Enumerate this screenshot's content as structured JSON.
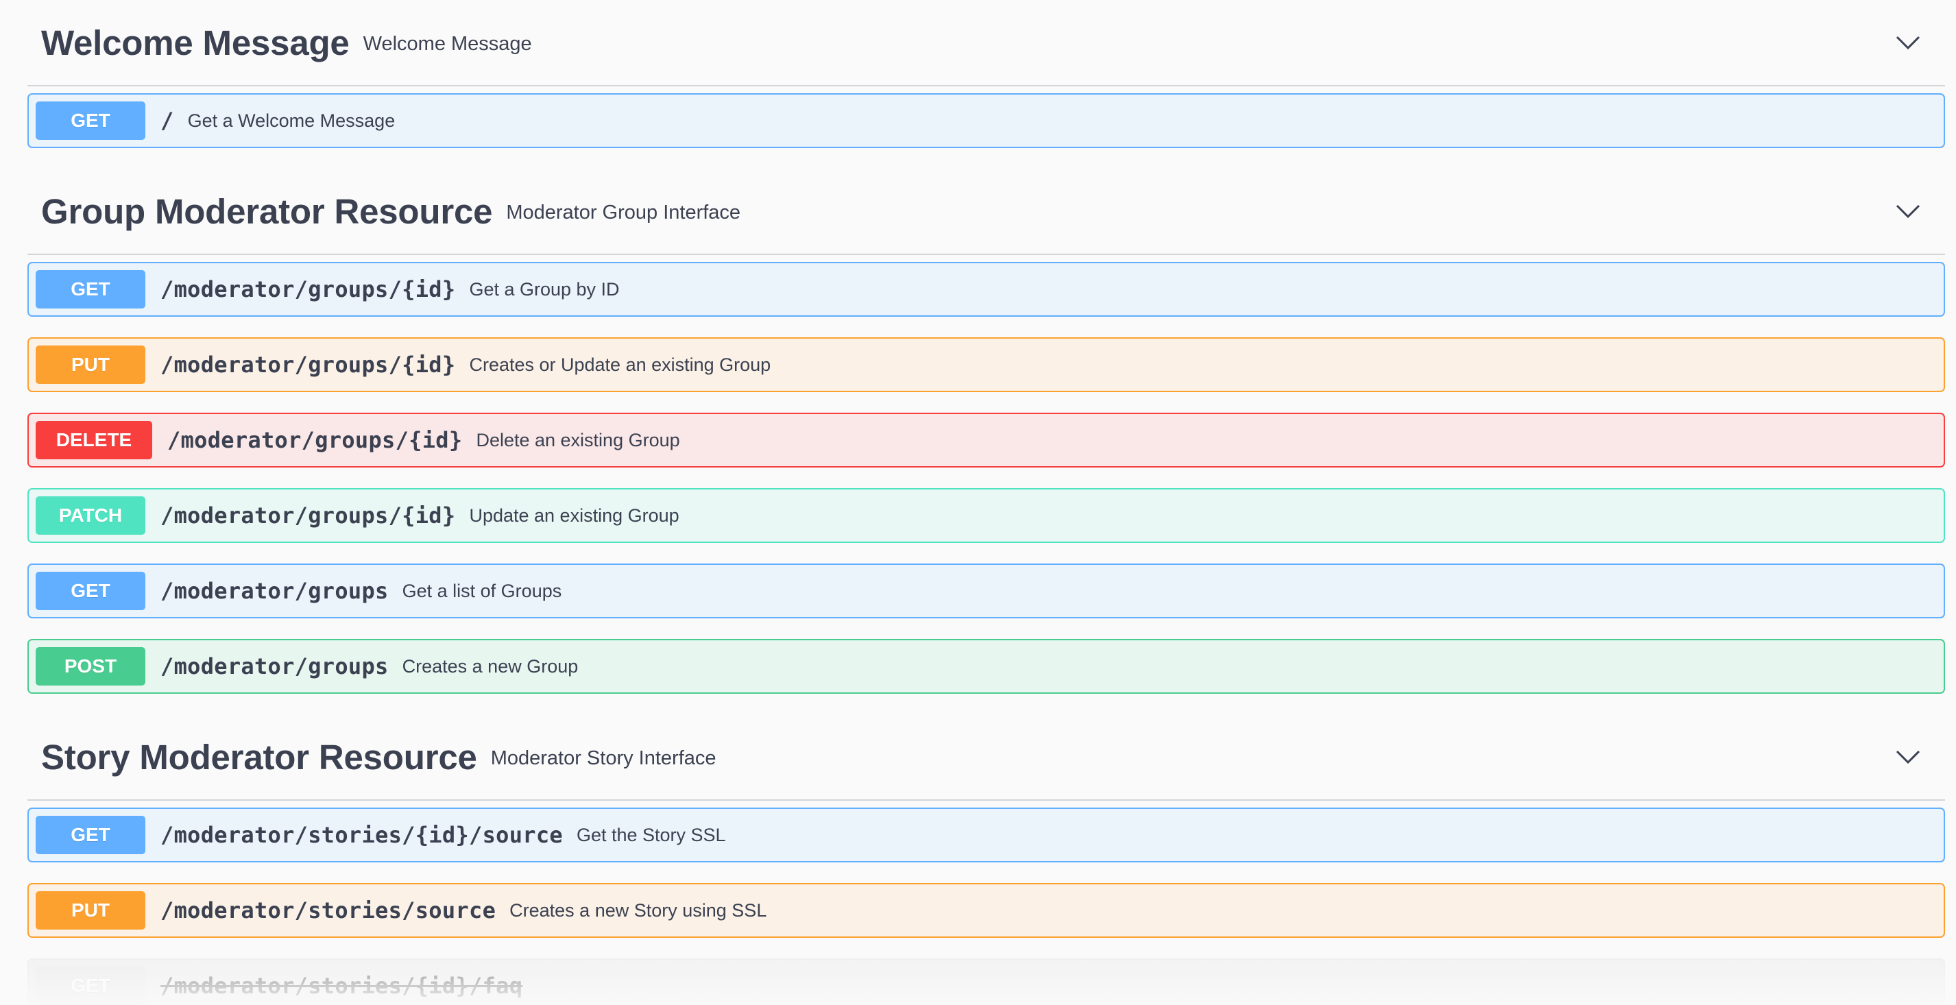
{
  "sections": [
    {
      "title": "Welcome Message",
      "description": "Welcome Message",
      "operations": [
        {
          "method": "GET",
          "path": "/",
          "summary": "Get a Welcome Message"
        }
      ]
    },
    {
      "title": "Group Moderator Resource",
      "description": "Moderator Group Interface",
      "operations": [
        {
          "method": "GET",
          "path": "/moderator/groups/{id}",
          "summary": "Get a Group by ID"
        },
        {
          "method": "PUT",
          "path": "/moderator/groups/{id}",
          "summary": "Creates or Update an existing Group"
        },
        {
          "method": "DELETE",
          "path": "/moderator/groups/{id}",
          "summary": "Delete an existing Group"
        },
        {
          "method": "PATCH",
          "path": "/moderator/groups/{id}",
          "summary": "Update an existing Group"
        },
        {
          "method": "GET",
          "path": "/moderator/groups",
          "summary": "Get a list of Groups"
        },
        {
          "method": "POST",
          "path": "/moderator/groups",
          "summary": "Creates a new Group"
        }
      ]
    },
    {
      "title": "Story Moderator Resource",
      "description": "Moderator Story Interface",
      "operations": [
        {
          "method": "GET",
          "path": "/moderator/stories/{id}/source",
          "summary": "Get the Story SSL"
        },
        {
          "method": "PUT",
          "path": "/moderator/stories/source",
          "summary": "Creates a new Story using SSL"
        },
        {
          "method": "GET",
          "path": "/moderator/stories/{id}/faq",
          "summary": "",
          "deprecated": true
        }
      ]
    }
  ],
  "icons": {
    "section_toggle": "chevron-down-icon"
  },
  "colors": {
    "get": "#61affe",
    "put": "#fca130",
    "delete": "#f93e3e",
    "patch": "#50e3c2",
    "post": "#49cc90",
    "text": "#3b4151",
    "background": "#fafafa"
  }
}
